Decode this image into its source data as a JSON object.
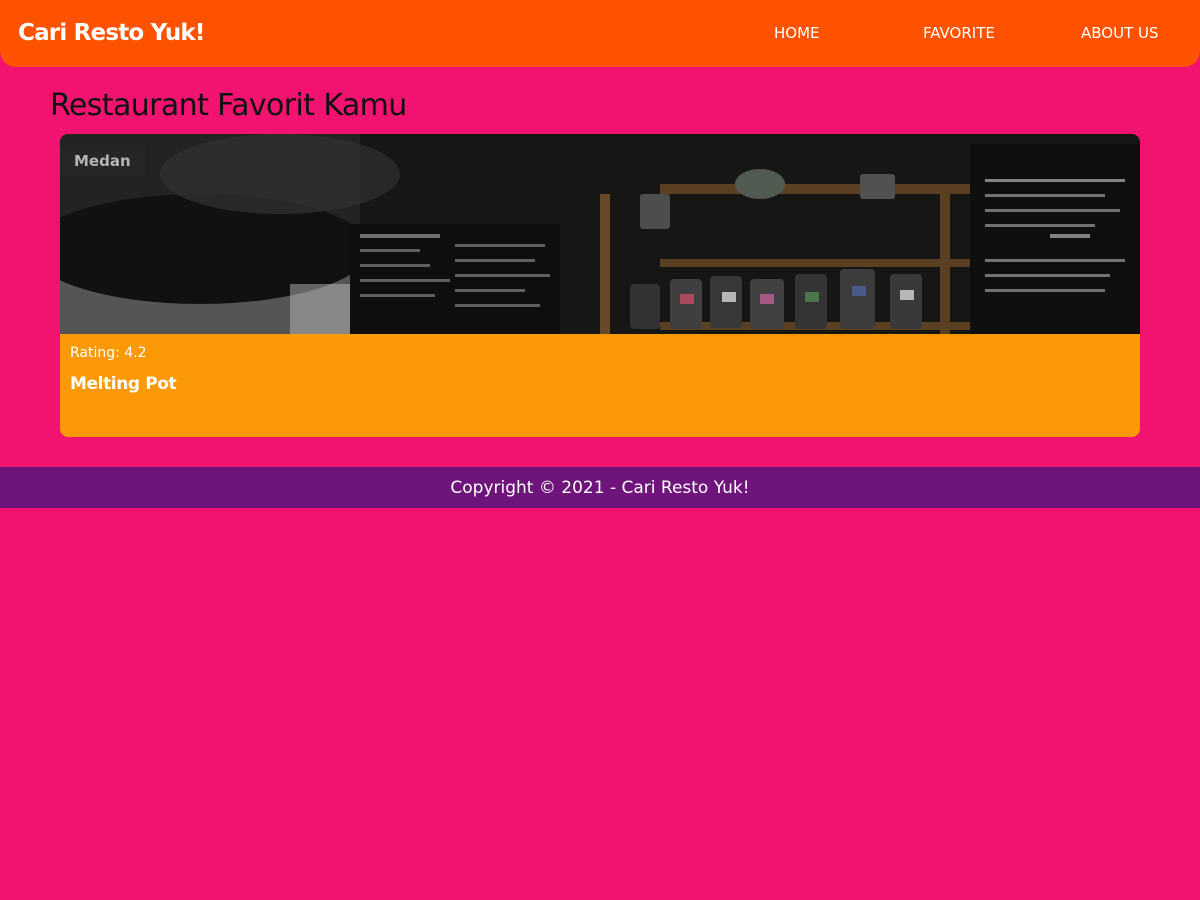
{
  "header": {
    "brand": "Cari Resto Yuk!",
    "nav": [
      {
        "label": "HOME"
      },
      {
        "label": "FAVORITE"
      },
      {
        "label": "ABOUT US"
      }
    ]
  },
  "main": {
    "title": "Restaurant Favorit Kamu",
    "restaurants": [
      {
        "city": "Medan",
        "rating_label": "Rating: ",
        "rating": "4.2",
        "name": "Melting Pot"
      }
    ]
  },
  "footer": {
    "text": "Copyright © 2021 - Cari Resto Yuk!"
  },
  "colors": {
    "background": "#f21270",
    "app_bar": "#ff5200",
    "card": "#fa9805",
    "footer": "#6e147b"
  }
}
